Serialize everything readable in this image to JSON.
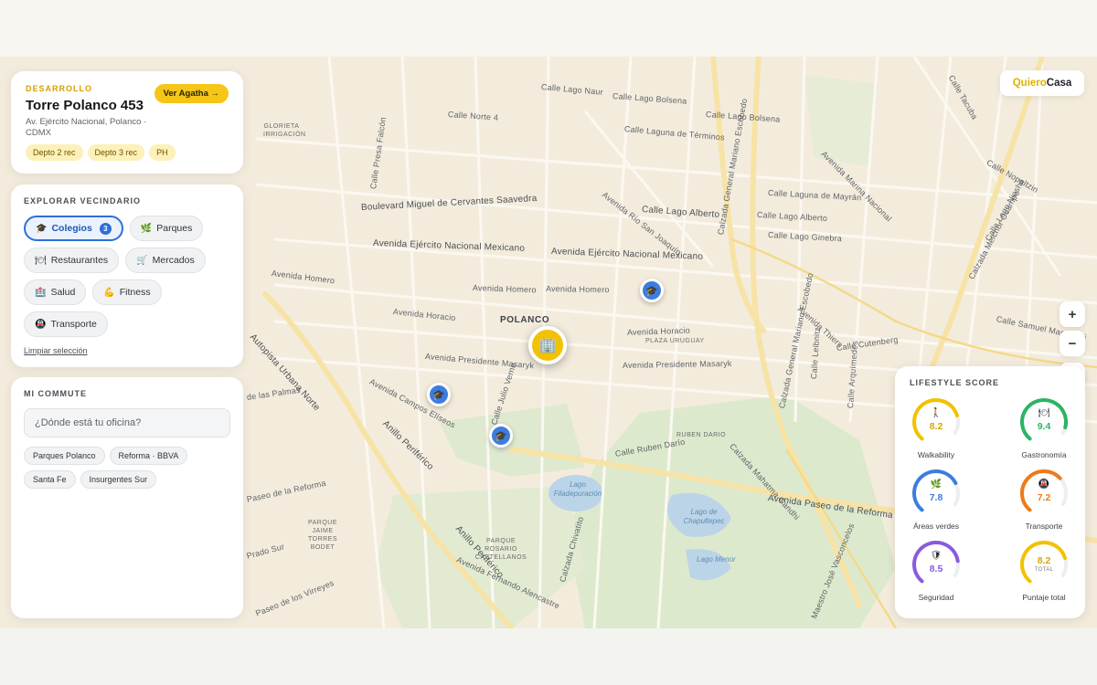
{
  "development": {
    "label": "DESARROLLO",
    "title": "Torre Polanco 453",
    "address": "Av. Ejército Nacional, Polanco · CDMX",
    "cta_label": "Ver Agatha →",
    "tags": [
      "Depto 2 rec",
      "Depto 3 rec",
      "PH"
    ]
  },
  "explore": {
    "title": "EXPLORAR VECINDARIO",
    "chips": [
      {
        "label": "Colegios",
        "icon": "graduation-cap-icon",
        "active": true,
        "count": "3"
      },
      {
        "label": "Parques",
        "icon": "leaf-icon",
        "active": false
      },
      {
        "label": "Restaurantes",
        "icon": "cutlery-icon",
        "active": false
      },
      {
        "label": "Mercados",
        "icon": "cart-icon",
        "active": false
      },
      {
        "label": "Salud",
        "icon": "hospital-icon",
        "active": false
      },
      {
        "label": "Fitness",
        "icon": "muscle-icon",
        "active": false
      },
      {
        "label": "Transporte",
        "icon": "bus-icon",
        "active": false
      }
    ],
    "clear_label": "Limpiar selección"
  },
  "commute": {
    "title": "MI COMMUTE",
    "placeholder": "¿Dónde está tu oficina?",
    "suggestions": [
      "Parques Polanco",
      "Reforma · BBVA",
      "Santa Fe",
      "Insurgentes Sur"
    ]
  },
  "brand": {
    "part1": "Quiero",
    "part2": "Casa"
  },
  "map_controls": {
    "zoom_in": "+",
    "zoom_out": "−",
    "home": "⌂"
  },
  "map": {
    "streets": [
      "Calle Lago Naur",
      "Calle Lago Bolsena",
      "Calle Lago Bolsena",
      "Calle Laguna de Términos",
      "Calle Norte 4",
      "Calle Presa Falcón",
      "Boulevard Miguel de Cervantes Saavedra",
      "Avenida Ejército Nacional Mexicano",
      "Avenida Ejército Nacional Mexicano",
      "Calle Lago Alberto",
      "Avenida Río San Joaquín",
      "Avenida Homero",
      "Avenida Homero",
      "Avenida Homero",
      "Avenida Horacio",
      "Avenida Horacio",
      "Avenida Presidente Masaryk",
      "Avenida Presidente Masaryk",
      "Calle Cutenberg",
      "Avenida Thiers",
      "Calzada General Mariano Escobedo",
      "Avenida Marina Nacional",
      "Calle Laguna de Mayrán",
      "Calle Lago Alberto",
      "Calle Lago Ginebra",
      "Calzada Melchor Ocampo",
      "Calle Nopaltzin",
      "Calle Samuel Manuel Vi",
      "Calle Ruben Darío",
      "Calzada Mahatma Gandhi",
      "Avenida Paseo de la Reforma",
      "Avenida Campos Elíseos",
      "Calle Julio Verne",
      "Autopista Urbana Norte",
      "Anillo Periférico",
      "Anillo Periférico",
      "Calle Leibnitz",
      "Calle Arquímedes",
      "Calzada Chivatito",
      "Avenida Fernando Alencastre",
      "Paseo de los Virreyes",
      "Calle Tacuba",
      "Calle Lago Nioshil",
      "Paseo de la Reforma",
      "Prado Sur",
      "de las Palmas",
      "Maestro José Vasconcelos",
      "Calzada General Mariano Escobedo"
    ],
    "places": [
      "GLORIETA IRRIGACIÓN",
      "POLANCO",
      "PLAZA URUGUAY",
      "RUBEN DARIO",
      "PARQUE JAIME TORRES BODET",
      "PARQUE ROSARIO CASTELLANOS"
    ],
    "water": [
      "Lago Filadepuración",
      "Lago de Chapultepec",
      "Lago Menor"
    ],
    "school_markers": 3,
    "main_marker_icon": "building-icon"
  },
  "lifestyle": {
    "title": "LIFESTYLE SCORE",
    "scores": [
      {
        "label": "Walkability",
        "value": "8.2",
        "fraction": 0.82,
        "icon": "walking-icon",
        "color": "#f2c200"
      },
      {
        "label": "Gastronomía",
        "value": "9.4",
        "fraction": 0.94,
        "icon": "cutlery-icon",
        "color": "#2bb463"
      },
      {
        "label": "Áreas verdes",
        "value": "7.8",
        "fraction": 0.78,
        "icon": "leaf-icon",
        "color": "#3b7de0"
      },
      {
        "label": "Transporte",
        "value": "7.2",
        "fraction": 0.72,
        "icon": "bus-icon",
        "color": "#ef7a1a"
      },
      {
        "label": "Seguridad",
        "value": "8.5",
        "fraction": 0.85,
        "icon": "shield-icon",
        "color": "#8a5be0"
      },
      {
        "label": "Puntaje total",
        "value": "8.2",
        "fraction": 0.82,
        "sub": "TOTAL",
        "color": "#f2c200"
      }
    ]
  }
}
